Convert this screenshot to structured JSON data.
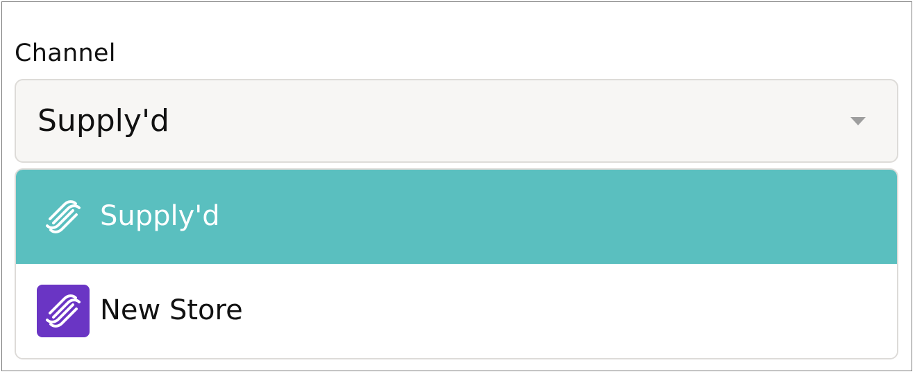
{
  "field": {
    "label": "Channel",
    "selected_value": "Supply'd",
    "caret_icon": "chevron-down-icon"
  },
  "menu": {
    "options": [
      {
        "label": "Supply'd",
        "icon": "supplyd-logo-icon",
        "selected": true,
        "highlight_color": "#5abfbf"
      },
      {
        "label": "New Store",
        "icon": "store-logo-icon",
        "selected": false,
        "icon_background": "#6a35c4"
      }
    ]
  }
}
